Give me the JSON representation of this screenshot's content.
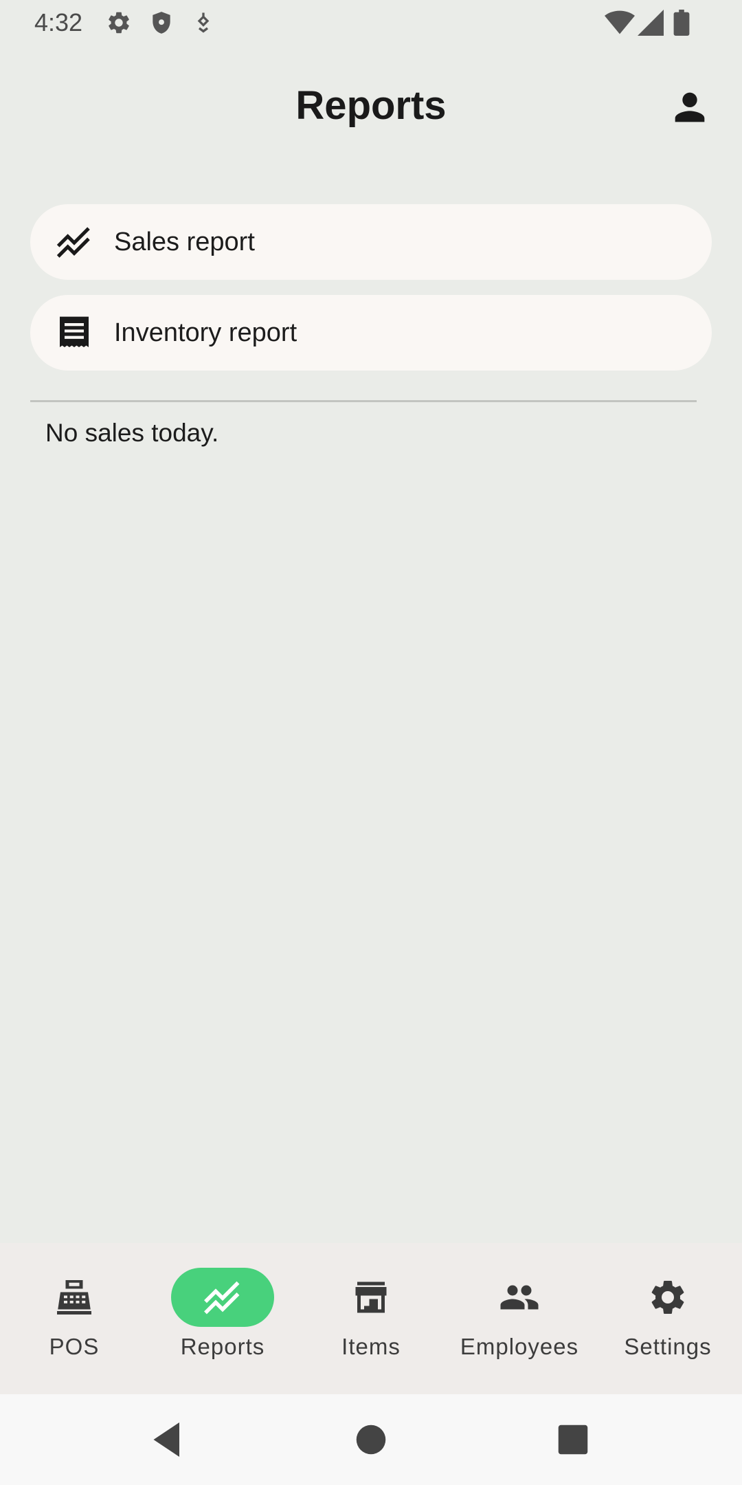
{
  "status_bar": {
    "time": "4:32",
    "left_icons": [
      "settings-gear-icon",
      "shield-icon",
      "location-pin-icon"
    ],
    "right_icons": [
      "wifi-icon",
      "cellular-signal-icon",
      "battery-icon"
    ]
  },
  "app_bar": {
    "title": "Reports",
    "account_icon": "account-person-icon"
  },
  "report_items": [
    {
      "label": "Sales report",
      "icon": "trending-chart-icon"
    },
    {
      "label": "Inventory report",
      "icon": "receipt-icon"
    }
  ],
  "summary": {
    "empty_text": "No sales today."
  },
  "bottom_nav": {
    "items": [
      {
        "label": "POS",
        "icon": "cash-register-icon",
        "active": false
      },
      {
        "label": "Reports",
        "icon": "trending-chart-icon",
        "active": true
      },
      {
        "label": "Items",
        "icon": "storefront-icon",
        "active": false
      },
      {
        "label": "Employees",
        "icon": "people-icon",
        "active": false
      },
      {
        "label": "Settings",
        "icon": "settings-gear-icon",
        "active": false
      }
    ]
  },
  "system_nav": [
    "back-icon",
    "home-icon",
    "recents-icon"
  ],
  "colors": {
    "background": "#eaece8",
    "card": "#faf7f4",
    "active_pill": "#48d17c",
    "bottom_nav_bg": "#efecea"
  }
}
